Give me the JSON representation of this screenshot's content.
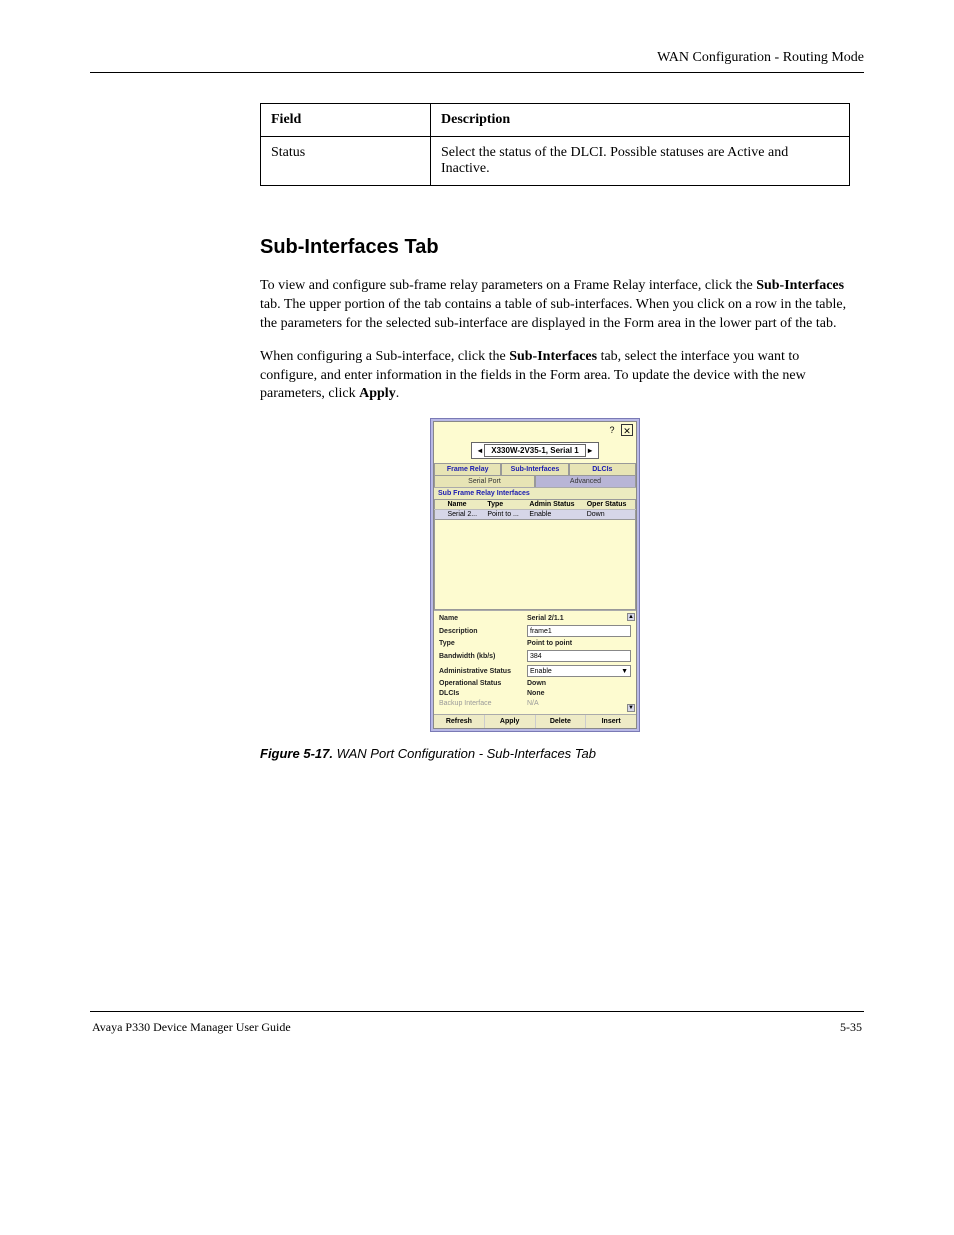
{
  "header": {
    "right": "WAN Configuration - Routing Mode"
  },
  "table": {
    "col_field": "Field",
    "col_desc": "Description",
    "row_field": "Status",
    "row_desc": "Select the status of the DLCI. Possible statuses are Active and Inactive."
  },
  "section": {
    "heading": "Sub-Interfaces Tab",
    "p1a": "To view and configure sub-frame relay parameters on a Frame Relay interface, click the ",
    "p1b": "Sub-Interfaces",
    "p1c": " tab. The upper portion of the tab contains a table of sub-interfaces. When you click on a row in the table, the parameters for the selected sub-interface are displayed in the Form area in the lower part of the tab.",
    "p2a": "When configuring a Sub-interface, click the ",
    "p2b": "Sub-Interfaces",
    "p2c": " tab, select the interface you want to configure, and enter information in the fields in the Form area. To update the device with the new parameters, click ",
    "p2d": "Apply",
    "p2e": "."
  },
  "gui": {
    "title": "X330W-2V35-1, Serial 1",
    "tabs_row1": {
      "frame_relay": "Frame Relay",
      "sub_interfaces": "Sub-Interfaces",
      "dlcis": "DLCIs"
    },
    "tabs_row2": {
      "serial_port": "Serial Port",
      "advanced": "Advanced"
    },
    "subtitle": "Sub Frame Relay Interfaces",
    "cols": {
      "name": "Name",
      "type": "Type",
      "admin": "Admin Status",
      "oper": "Oper Status"
    },
    "row": {
      "name": "Serial 2...",
      "type": "Point to ...",
      "admin": "Enable",
      "oper": "Down"
    },
    "form": {
      "name_lbl": "Name",
      "name_val": "Serial 2/1.1",
      "desc_lbl": "Description",
      "desc_val": "frame1",
      "type_lbl": "Type",
      "type_val": "Point to point",
      "bw_lbl": "Bandwidth (kb/s)",
      "bw_val": "384",
      "admin_lbl": "Administrative Status",
      "admin_val": "Enable",
      "oper_lbl": "Operational Status",
      "oper_val": "Down",
      "dlcis_lbl": "DLCIs",
      "dlcis_val": "None",
      "backup_lbl": "Backup Interface",
      "backup_val": "N/A"
    },
    "buttons": {
      "refresh": "Refresh",
      "apply": "Apply",
      "delete": "Delete",
      "insert": "Insert"
    }
  },
  "caption_label": "Figure 5-17.",
  "caption_text": "WAN Port Configuration - Sub-Interfaces Tab",
  "footer": {
    "left": "Avaya P330 Device Manager User Guide",
    "right": "5-35"
  }
}
